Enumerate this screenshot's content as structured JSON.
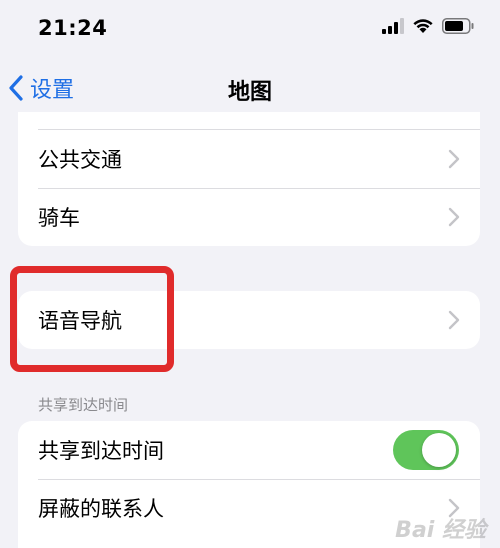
{
  "status_bar": {
    "time": "21:24"
  },
  "nav": {
    "back_label": "设置",
    "title": "地图"
  },
  "route_group": {
    "items": [
      {
        "label": "公共交通"
      },
      {
        "label": "骑车"
      }
    ]
  },
  "voice_group": {
    "items": [
      {
        "label": "语音导航"
      }
    ]
  },
  "share_section": {
    "header": "共享到达时间",
    "items": [
      {
        "label": "共享到达时间",
        "toggle_on": true
      },
      {
        "label": "屏蔽的联系人"
      }
    ]
  },
  "watermark": {
    "text": "Bai 经验"
  },
  "colors": {
    "accent": "#1f6fe5",
    "toggle_on": "#5fc55a",
    "highlight": "#e02b2b",
    "background": "#f2f2f7"
  }
}
